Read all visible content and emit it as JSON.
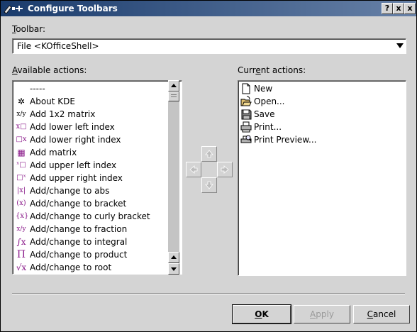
{
  "window": {
    "title": "Configure Toolbars",
    "help_label": "?",
    "close_label": "x",
    "extra_label": "x"
  },
  "toolbar_label": {
    "pre": "",
    "accel": "T",
    "post": "oolbar:"
  },
  "toolbar_combo": {
    "value": "File <KOfficeShell>"
  },
  "available_label": {
    "pre": "",
    "accel": "A",
    "post": "vailable actions:"
  },
  "current_label": {
    "pre": "Curr",
    "accel": "e",
    "post": "nt actions:"
  },
  "available_actions": [
    {
      "label": "-----",
      "icon": "separator"
    },
    {
      "label": "About KDE",
      "icon": "kde-gear-icon",
      "glyph": "✲"
    },
    {
      "label": "Add 1x2 matrix",
      "icon": "matrix-1x2-icon",
      "glyph": "x/y"
    },
    {
      "label": "Add lower left index",
      "icon": "lower-left-index-icon",
      "glyph": "x□"
    },
    {
      "label": "Add lower right index",
      "icon": "lower-right-index-icon",
      "glyph": "□x"
    },
    {
      "label": "Add matrix",
      "icon": "matrix-icon",
      "glyph": "▦"
    },
    {
      "label": "Add upper left index",
      "icon": "upper-left-index-icon",
      "glyph": "ˣ□"
    },
    {
      "label": "Add upper right index",
      "icon": "upper-right-index-icon",
      "glyph": "□ˣ"
    },
    {
      "label": "Add/change to abs",
      "icon": "abs-icon",
      "glyph": "|x|"
    },
    {
      "label": "Add/change to bracket",
      "icon": "bracket-icon",
      "glyph": "(x)"
    },
    {
      "label": "Add/change to curly bracket",
      "icon": "curly-bracket-icon",
      "glyph": "{x}"
    },
    {
      "label": "Add/change to fraction",
      "icon": "fraction-icon",
      "glyph": "x/y"
    },
    {
      "label": "Add/change to integral",
      "icon": "integral-icon",
      "glyph": "∫x"
    },
    {
      "label": "Add/change to product",
      "icon": "product-icon",
      "glyph": "Π"
    },
    {
      "label": "Add/change to root",
      "icon": "root-icon",
      "glyph": "√x"
    }
  ],
  "current_actions": [
    {
      "label": "New",
      "icon": "new-document-icon"
    },
    {
      "label": "Open...",
      "icon": "open-folder-icon"
    },
    {
      "label": "Save",
      "icon": "save-disk-icon"
    },
    {
      "label": "Print...",
      "icon": "printer-icon"
    },
    {
      "label": "Print Preview...",
      "icon": "print-preview-icon"
    }
  ],
  "buttons": {
    "ok": {
      "accel": "O",
      "rest": "K"
    },
    "apply": {
      "accel": "A",
      "rest": "pply"
    },
    "cancel": {
      "accel": "C",
      "rest": "ancel"
    }
  }
}
